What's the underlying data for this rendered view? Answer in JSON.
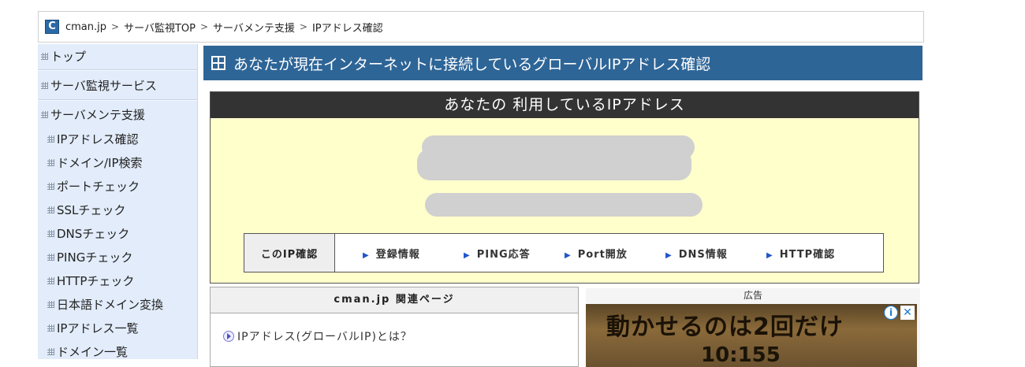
{
  "breadcrumb": {
    "logo": "C",
    "items": [
      "cman.jp",
      "サーバ監視TOP",
      "サーバメンテ支援",
      "IPアドレス確認"
    ],
    "separator": ">"
  },
  "sidebar": {
    "sections": [
      "トップ",
      "サーバ監視サービス",
      "サーバメンテ支援"
    ],
    "items": [
      "IPアドレス確認",
      "ドメイン/IP検索",
      "ポートチェック",
      "SSLチェック",
      "DNSチェック",
      "PINGチェック",
      "HTTPチェック",
      "日本語ドメイン変換",
      "IPアドレス一覧",
      "ドメイン一覧"
    ]
  },
  "page_title": "あなたが現在インターネットに接続しているグローバルIPアドレス確認",
  "ip_box": {
    "heading": "あなたの 利用しているIPアドレス",
    "check_label": "このIP確認",
    "links": [
      "登録情報",
      "PING応答",
      "Port開放",
      "DNS情報",
      "HTTP確認"
    ]
  },
  "related": {
    "heading": "cman.jp 関連ページ",
    "items": [
      "IPアドレス(グローバルIP)とは？"
    ]
  },
  "ad": {
    "label": "広告",
    "headline": "動かせるのは2回だけ",
    "subtext": "10:155",
    "info_icon": "i",
    "close_icon": "✕"
  },
  "colors": {
    "title_bar": "#2e6597",
    "sidebar_bg": "#e2ecfa",
    "ip_box_bg": "#ffffcc",
    "ip_head_bg": "#333333"
  }
}
